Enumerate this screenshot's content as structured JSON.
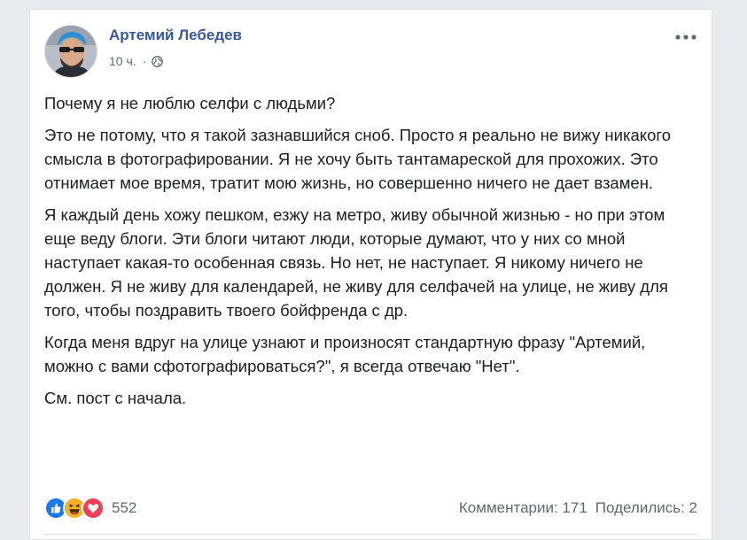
{
  "post": {
    "author": "Артемий Лебедев",
    "time": "10 ч.",
    "separator": "·",
    "privacy_icon": "globe-icon",
    "more_icon": "more-options-icon",
    "paragraphs": [
      "Почему я не люблю селфи с людьми?",
      "Это не потому, что я такой зазнавшийся сноб. Просто я реально не вижу никакого смысла в фотографировании. Я не хочу быть тантамареской для прохожих. Это отнимает мое время, тратит мою жизнь, но совершенно ничего не дает взамен.",
      "Я каждый день хожу пешком, езжу на метро, живу обычной жизнью - но при этом еще веду блоги. Эти блоги читают люди, которые думают, что у них со мной наступает какая-то особенная связь. Но нет, не наступает. Я никому ничего не должен. Я не живу для календарей, не живу для селфачей на улице, не живу для того, чтобы поздравить твоего бойфренда с др.",
      "Когда меня вдруг на улице узнают и произносят стандартную фразу \"Артемий, можно с вами сфотографироваться?\", я всегда отвечаю \"Нет\".",
      "См. пост с начала."
    ]
  },
  "footer": {
    "reactions": [
      "like-icon",
      "haha-icon",
      "love-icon"
    ],
    "reaction_count": "552",
    "comments": "Комментарии: 171",
    "shares": "Поделились: 2"
  },
  "colors": {
    "author": "#385898",
    "text": "#1c1e21",
    "meta": "#616770",
    "like": "#1877f2",
    "haha": "#f7b125",
    "love": "#f33e58",
    "background": "#e9ebee"
  }
}
